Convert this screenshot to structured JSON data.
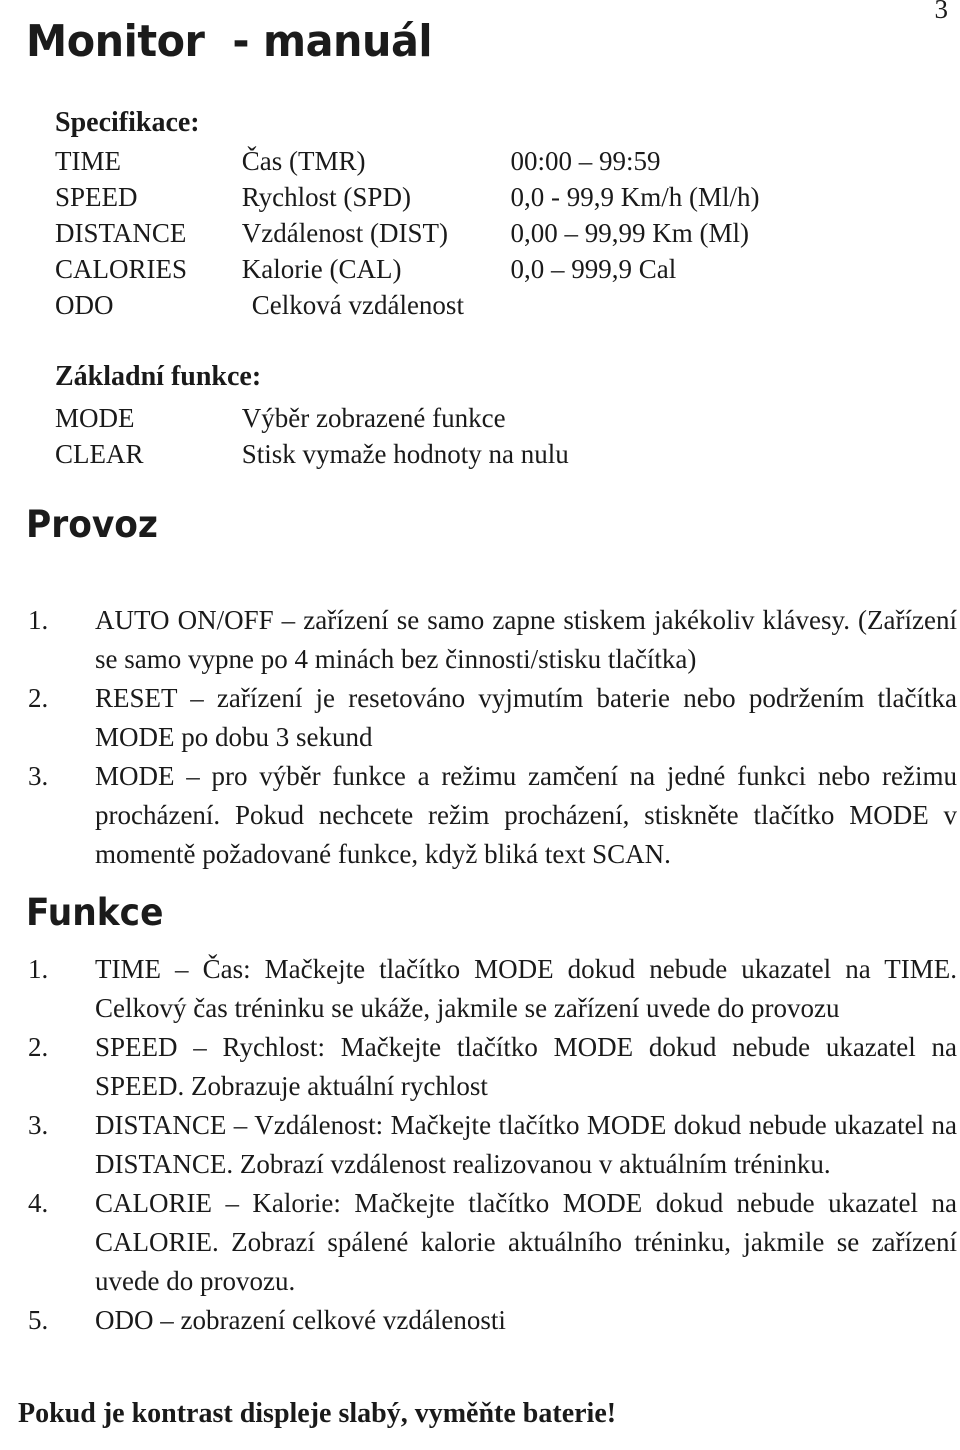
{
  "page": {
    "number": "3",
    "title": "Monitor  - manuál"
  },
  "specifications": {
    "heading": "Specifikace:",
    "rows": [
      {
        "key": "TIME",
        "name": "Čas (TMR)",
        "range": "00:00 – 99:59"
      },
      {
        "key": "SPEED",
        "name": "Rychlost (SPD)",
        "range": "0,0 - 99,9 Km/h (Ml/h)"
      },
      {
        "key": "DISTANCE",
        "name": "Vzdálenost (DIST)",
        "range": "0,00 – 99,99 Km (Ml)"
      },
      {
        "key": "CALORIES",
        "name": "Kalorie (CAL)",
        "range": "0,0 – 999,9 Cal"
      },
      {
        "key": "ODO",
        "name": "Celková vzdálenost",
        "range": ""
      }
    ]
  },
  "basic_functions": {
    "heading": "Základní funkce:",
    "rows": [
      {
        "key": "MODE",
        "name": "Výběr zobrazené funkce"
      },
      {
        "key": "CLEAR",
        "name": "Stisk vymaže hodnoty na nulu"
      }
    ]
  },
  "operation": {
    "heading": "Provoz",
    "items": [
      {
        "marker": "1.",
        "text": "AUTO ON/OFF – zařízení se samo zapne stiskem jakékoliv  klávesy. (Zařízení se samo vypne po 4 minách bez činnosti/stisku tlačítka)"
      },
      {
        "marker": "2.",
        "text": "RESET – zařízení je resetováno vyjmutím baterie nebo podržením tlačítka MODE po dobu 3 sekund"
      },
      {
        "marker": "3.",
        "text": "MODE – pro výběr funkce a režimu zamčení na jedné funkci nebo režimu procházení. Pokud nechcete režim procházení, stiskněte tlačítko MODE v momentě požadované funkce, když bliká text SCAN."
      }
    ]
  },
  "functions": {
    "heading": "Funkce",
    "items": [
      {
        "marker": "1.",
        "text": "TIME – Čas: Mačkejte tlačítko MODE dokud nebude ukazatel na TIME. Celkový čas tréninku se ukáže, jakmile se zařízení uvede do provozu"
      },
      {
        "marker": "2.",
        "text": "SPEED – Rychlost: Mačkejte tlačítko MODE dokud nebude ukazatel na SPEED. Zobrazuje aktuální rychlost"
      },
      {
        "marker": "3.",
        "text": "DISTANCE – Vzdálenost: Mačkejte tlačítko MODE dokud nebude ukazatel na DISTANCE. Zobrazí vzdálenost realizovanou v aktuálním tréninku."
      },
      {
        "marker": "4.",
        "text": "CALORIE – Kalorie: Mačkejte tlačítko MODE dokud nebude ukazatel na CALORIE. Zobrazí spálené kalorie aktuálního tréninku, jakmile se zařízení uvede do provozu."
      },
      {
        "marker": "5.",
        "text": "ODO – zobrazení celkové vzdálenosti"
      }
    ]
  },
  "footer": {
    "note": "Pokud je kontrast displeje slabý, vyměňte baterie!"
  }
}
